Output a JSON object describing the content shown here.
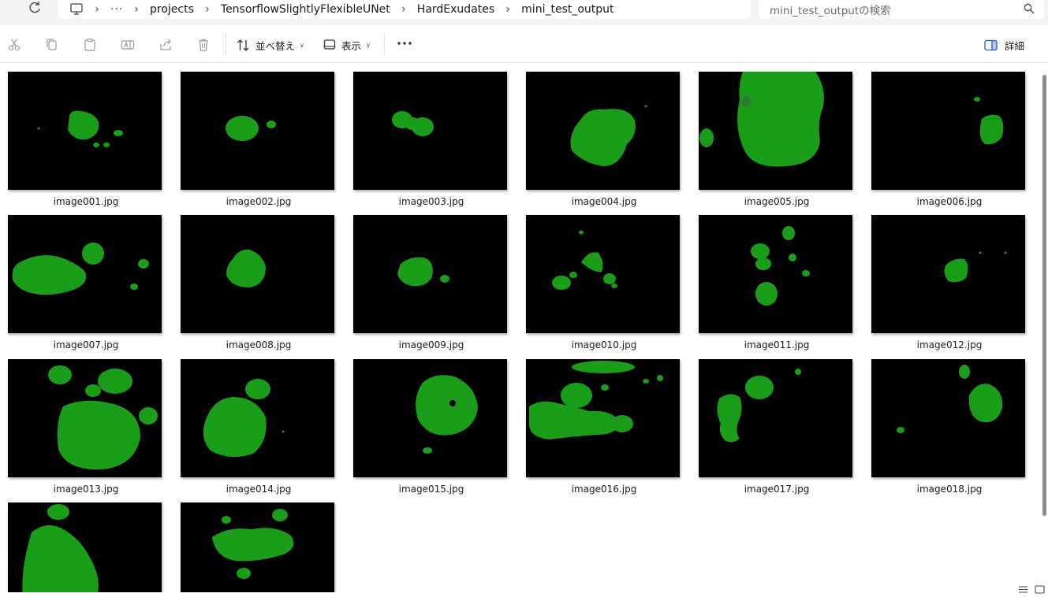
{
  "address_bar": {
    "breadcrumbs": [
      "projects",
      "TensorflowSlightlyFlexibleUNet",
      "HardExudates",
      "mini_test_output"
    ],
    "overflow": "···"
  },
  "search": {
    "placeholder": "mini_test_outputの検索"
  },
  "toolbar": {
    "sort_label": "並べ替え",
    "view_label": "表示",
    "details_label": "詳細"
  },
  "files": [
    {
      "name": "image001.jpg"
    },
    {
      "name": "image002.jpg"
    },
    {
      "name": "image003.jpg"
    },
    {
      "name": "image004.jpg"
    },
    {
      "name": "image005.jpg"
    },
    {
      "name": "image006.jpg"
    },
    {
      "name": "image007.jpg"
    },
    {
      "name": "image008.jpg"
    },
    {
      "name": "image009.jpg"
    },
    {
      "name": "image010.jpg"
    },
    {
      "name": "image011.jpg"
    },
    {
      "name": "image012.jpg"
    },
    {
      "name": "image013.jpg"
    },
    {
      "name": "image014.jpg"
    },
    {
      "name": "image015.jpg"
    },
    {
      "name": "image016.jpg"
    },
    {
      "name": "image017.jpg"
    },
    {
      "name": "image018.jpg"
    },
    {
      "name": ""
    },
    {
      "name": ""
    }
  ],
  "colors": {
    "mask_green": "#1a9e1a",
    "thumb_bg": "#000000"
  }
}
